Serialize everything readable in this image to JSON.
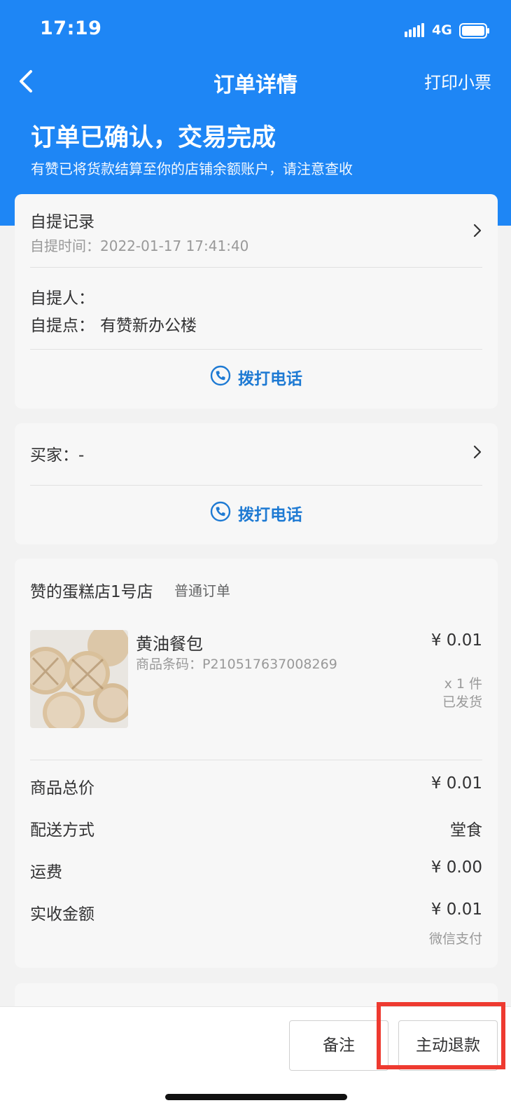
{
  "status_bar": {
    "time": "17:19",
    "network": "4G"
  },
  "nav": {
    "title": "订单详情",
    "print_label": "打印小票"
  },
  "order_status": {
    "title": "订单已确认，交易完成",
    "desc": "有赞已将货款结算至你的店铺余额账户，请注意查收"
  },
  "pickup": {
    "record_label": "自提记录",
    "record_time": "自提时间：2022-01-17 17:41:40",
    "person_label": "自提人：",
    "person_value": "",
    "point_label": "自提点：",
    "point_value": "有赞新办公楼",
    "call_label": "拨打电话"
  },
  "buyer": {
    "label": "买家：-",
    "call_label": "拨打电话"
  },
  "order": {
    "shop_name": "赞的蛋糕店1号店",
    "order_type": "普通订单",
    "product": {
      "name": "黄油餐包",
      "code": "商品条码：P210517637008269",
      "price": "¥ 0.01",
      "quantity": "x 1 件",
      "state": "已发货"
    },
    "summary": [
      {
        "label": "商品总价",
        "value": "¥ 0.01"
      },
      {
        "label": "配送方式",
        "value": "堂食"
      },
      {
        "label": "运费",
        "value": "¥ 0.00"
      },
      {
        "label": "实收金额",
        "value": "¥ 0.01",
        "note": "微信支付"
      }
    ]
  },
  "bottom_bar": {
    "remark_label": "备注",
    "refund_label": "主动退款"
  },
  "colors": {
    "brand_blue": "#1e86f5",
    "link_blue": "#1e7ad3",
    "highlight_red": "#ee3a30"
  },
  "icons": [
    "back-icon",
    "chevron-right-icon",
    "phone-icon",
    "signal-icon",
    "battery-icon"
  ]
}
